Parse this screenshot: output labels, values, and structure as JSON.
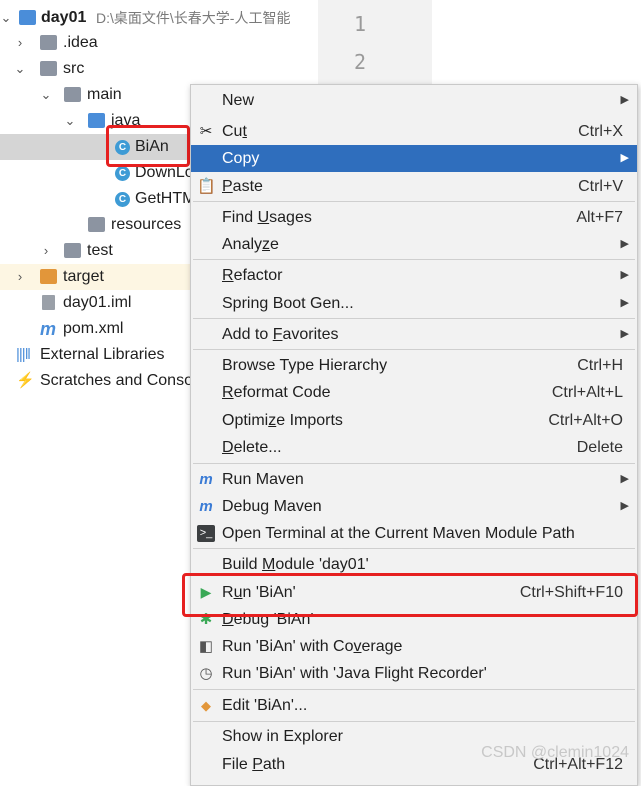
{
  "project_root": {
    "name": "day01",
    "path": "D:\\桌面文件\\长春大学-人工智能"
  },
  "tree": {
    "idea": ".idea",
    "src": "src",
    "main": "main",
    "java": "java",
    "bian": "BiAn",
    "downl": "DownLo",
    "gethtm": "GetHTM",
    "resources": "resources",
    "test": "test",
    "target": "target",
    "iml": "day01.iml",
    "pom": "pom.xml",
    "external": "External Libraries",
    "scratches": "Scratches and Conso"
  },
  "gutter": [
    "1",
    "2"
  ],
  "menu": {
    "new": "New",
    "cut": {
      "pre": "Cu",
      "u": "t",
      "post": "",
      "shortcut": "Ctrl+X"
    },
    "copy": "Copy",
    "paste": {
      "pre": "",
      "u": "P",
      "post": "aste",
      "shortcut": "Ctrl+V"
    },
    "find_usages": {
      "pre": "Find ",
      "u": "U",
      "post": "sages",
      "shortcut": "Alt+F7"
    },
    "analyze": {
      "pre": "Analy",
      "u": "z",
      "post": "e"
    },
    "refactor": {
      "pre": "",
      "u": "R",
      "post": "efactor"
    },
    "spring_boot": "Spring Boot Gen...",
    "add_favorites": {
      "pre": "Add to ",
      "u": "F",
      "post": "avorites"
    },
    "browse_hierarchy": {
      "label": "Browse Type Hierarchy",
      "shortcut": "Ctrl+H"
    },
    "reformat": {
      "pre": "",
      "u": "R",
      "post": "eformat Code",
      "shortcut": "Ctrl+Alt+L"
    },
    "optimize": {
      "pre": "Optimi",
      "u": "z",
      "post": "e Imports",
      "shortcut": "Ctrl+Alt+O"
    },
    "delete": {
      "pre": "",
      "u": "D",
      "post": "elete...",
      "shortcut": "Delete"
    },
    "run_maven": "Run Maven",
    "debug_maven": "Debug Maven",
    "open_terminal": "Open Terminal at the Current Maven Module Path",
    "build_module": {
      "pre": "Build ",
      "u": "M",
      "post": "odule 'day01'"
    },
    "run_bian": {
      "pre": "R",
      "u": "u",
      "post": "n 'BiAn'",
      "shortcut": "Ctrl+Shift+F10"
    },
    "debug_bian": {
      "pre": "",
      "u": "D",
      "post": "ebug 'BiAn'"
    },
    "run_coverage": {
      "pre": "Run 'BiAn' with Co",
      "u": "v",
      "post": "erage"
    },
    "run_jfr": "Run 'BiAn' with 'Java Flight Recorder'",
    "edit_bian": "Edit 'BiAn'...",
    "show_explorer": "Show in Explorer",
    "file_path": {
      "pre": "File ",
      "u": "P",
      "post": "ath",
      "shortcut": "Ctrl+Alt+F12"
    }
  },
  "watermark": "CSDN @clemin1024",
  "colors": {
    "selection": "#2f6ebd",
    "highlight_box": "#e62020",
    "run_icon": "#3aa856"
  }
}
